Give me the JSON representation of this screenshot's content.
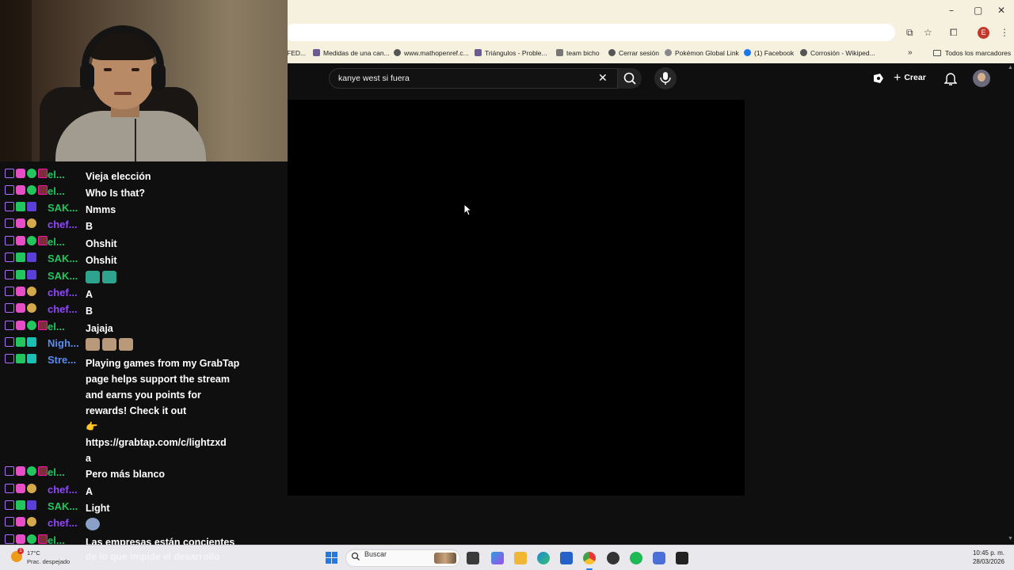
{
  "browser": {
    "window_controls": {
      "minimize": "–",
      "maximize": "▢",
      "close": "✕"
    },
    "profile_letter": "E",
    "bookmarks": [
      "FED...",
      "Medidas de una can...",
      "www.mathopenref.c...",
      "Triángulos - Proble...",
      "team bicho",
      "Cerrar sesión",
      "Pokémon Global Link",
      "(1) Facebook",
      "Corrosión - Wikiped..."
    ],
    "bookmarks_more": "»",
    "all_bookmarks": "Todos los marcadores"
  },
  "youtube": {
    "search_query": "kanye west si fuera",
    "create_label": "Crear"
  },
  "chat": {
    "messages": [
      {
        "user": "el...",
        "text": "Vieja elección"
      },
      {
        "user": "el...",
        "text": "Who Is that?"
      },
      {
        "user": "SAK...",
        "text": "Nmms"
      },
      {
        "user": "chef...",
        "text": "B"
      },
      {
        "user": "el...",
        "text": "Ohshit"
      },
      {
        "user": "SAK...",
        "text": "Ohshit"
      },
      {
        "user": "SAK...",
        "text": ""
      },
      {
        "user": "chef...",
        "text": "A"
      },
      {
        "user": "chef...",
        "text": "B"
      },
      {
        "user": "el...",
        "text": "Jajaja"
      },
      {
        "user": "Nigh...",
        "text": ""
      },
      {
        "user": "Stre...",
        "text": "Playing games from my GrabTap page helps support the stream and earns you points for rewards! Check it out"
      },
      {
        "user": "el...",
        "text": "Pero más blanco"
      },
      {
        "user": "chef...",
        "text": "A"
      },
      {
        "user": "SAK...",
        "text": "Light"
      },
      {
        "user": "chef...",
        "text": ""
      },
      {
        "user": "el...",
        "text": "Las empresas están concientes"
      }
    ],
    "long_message_link": "https://grabtap.com/c/lightzxd",
    "long_message_tail": "a",
    "overflow_text": "de lo que impide el desarrollo"
  },
  "taskbar": {
    "temperature": "17°C",
    "condition": "Prac. despejado",
    "search_placeholder": "Buscar",
    "time": "10:45 p. m.",
    "date": "28/03/2026",
    "weather_badge": "1"
  },
  "colors": {
    "chrome_bg": "#f6f0df",
    "yt_bg": "#0f0f0f",
    "green_user": "#22c55e",
    "purple_user": "#9146ff",
    "blue_user": "#5b8def"
  }
}
